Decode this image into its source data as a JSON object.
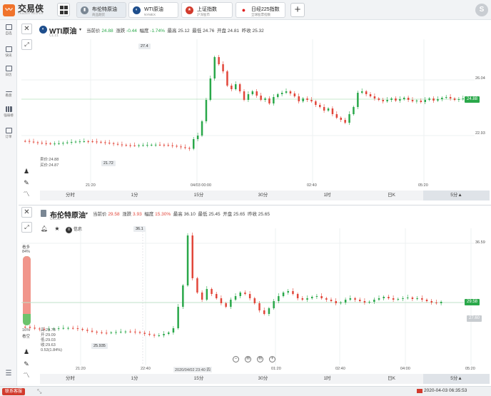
{
  "app": {
    "name": "交易侠",
    "subtitle": "TRADER HELPER",
    "avatar": "S"
  },
  "tabs": [
    {
      "name": "布伦特原油",
      "sub": "商品期货",
      "icon_color": "#7a8794",
      "icon": "▮",
      "active": true
    },
    {
      "name": "WTI原油",
      "sub": "NYMEX",
      "icon_color": "#1e4e8c",
      "icon": "◐",
      "active": false
    },
    {
      "name": "上证指数",
      "sub": "沪深股市",
      "icon_color": "#d23b2d",
      "icon": "★",
      "active": false
    },
    {
      "name": "日经225指数",
      "sub": "全球股票指数",
      "icon_color": "#e02020",
      "icon": "●",
      "active": false
    }
  ],
  "add_tab": "+",
  "sidebar": [
    {
      "label": "自选",
      "icon": "bookmark-icon"
    },
    {
      "label": "快讯",
      "icon": "news-icon"
    },
    {
      "label": "日历",
      "icon": "calendar-icon"
    },
    {
      "label": "看盘",
      "icon": "chart-icon"
    },
    {
      "label": "强弱榜",
      "icon": "rank-icon"
    },
    {
      "label": "订单",
      "icon": "order-icon"
    }
  ],
  "panel1": {
    "title": "WTI原油",
    "symbol": "CL.c1",
    "stats": {
      "current_label": "当前价",
      "current": "24.88",
      "change_label": "涨跌",
      "change": "-0.44",
      "pct_label": "幅度",
      "pct": "-1.74%",
      "high_label": "最高",
      "high": "25.12",
      "low_label": "最低",
      "low": "24.76",
      "open_label": "开盘",
      "open": "24.81",
      "prev_label": "昨收",
      "prev": "25.32"
    },
    "price_labels": [
      "26.04",
      "22.93"
    ],
    "current_tag": "24.88",
    "peak_callout": "27.4",
    "low_callout": "21.72",
    "sell_text": "卖价:24.88",
    "buy_text": "买价:24.87",
    "time_labels": [
      "21:20",
      "04/03 00:00",
      "02:40",
      "05:20"
    ],
    "timeframes": [
      "分时",
      "1分",
      "15分",
      "30分",
      "1时",
      "日K",
      "5分▲"
    ]
  },
  "panel2": {
    "title": "布伦特原油",
    "symbol": "UKOIL",
    "stats": {
      "current_label": "当前价",
      "current": "29.58",
      "change_label": "涨跌",
      "change": "3.93",
      "pct_label": "幅度",
      "pct": "15.30%",
      "high_label": "最高",
      "high": "36.10",
      "low_label": "最低",
      "low": "25.45",
      "open_label": "开盘",
      "open": "25.65",
      "prev_label": "昨收",
      "prev": "25.65"
    },
    "info_label": "信息",
    "bull_label": "看多",
    "bull_pct": "84%",
    "bear_pct": "16%",
    "bear_label": "看空",
    "bull_fraction": 0.84,
    "price_labels": [
      "36.59",
      "27.60"
    ],
    "current_tag": "29.58",
    "peak_callout": "36.1",
    "low_callout": "25.935",
    "ohlc": [
      "高:29.78",
      "开:29.09",
      "低:29.03",
      "收:29.63",
      "0.53(1.84%)"
    ],
    "time_labels": [
      "21:20",
      "22:40",
      "01:20",
      "02:40",
      "04:00",
      "05:20"
    ],
    "cursor_time": "2020/04/02 23:40 四",
    "nav": [
      "−",
      "H",
      "H",
      "+"
    ],
    "timeframes": [
      "分时",
      "1分",
      "15分",
      "30分",
      "1时",
      "日K",
      "5分▲"
    ]
  },
  "footer": {
    "contact": "联系客服",
    "clock": "2020-04-03 06:35:53"
  },
  "colors": {
    "up": "#e2463a",
    "down": "#2aa84a",
    "accent": "#f0732b"
  }
}
